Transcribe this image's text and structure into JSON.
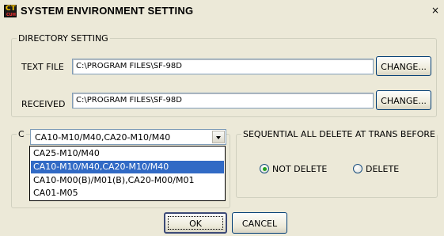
{
  "window": {
    "title": "SYSTEM ENVIRONMENT SETTING",
    "close_glyph": "×",
    "icon_text_top": "CT",
    "icon_text_bottom": "CUH"
  },
  "directory": {
    "group_label": "DIRECTORY SETTING",
    "text_file_label": "TEXT FILE",
    "text_file_value": "C:\\PROGRAM FILES\\SF-98D",
    "received_label": "RECEIVED",
    "received_value": "C:\\PROGRAM FILES\\SF-98D",
    "change_label": "CHANGE..."
  },
  "model": {
    "group_label_visible": "C",
    "selected": "CA10-M10/M40,CA20-M10/M40",
    "options": [
      "CA25-M10/M40",
      "CA10-M10/M40,CA20-M10/M40",
      "CA10-M00(B)/M01(B),CA20-M00/M01",
      "CA01-M05"
    ],
    "highlighted_index": 1
  },
  "sequential": {
    "group_label": "SEQUENTIAL ALL DELETE AT TRANS BEFORE",
    "options": [
      {
        "label": "NOT DELETE",
        "checked": true
      },
      {
        "label": "DELETE",
        "checked": false
      }
    ]
  },
  "footer": {
    "ok_label": "OK",
    "cancel_label": "CANCEL"
  }
}
